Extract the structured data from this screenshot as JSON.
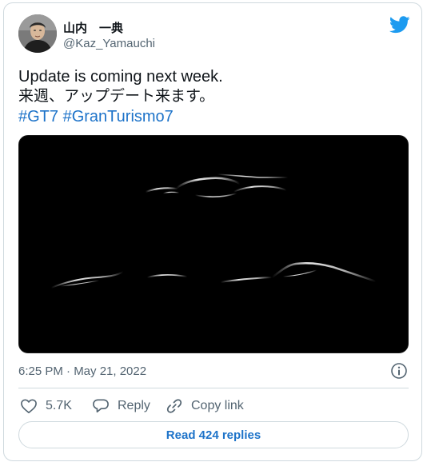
{
  "author": {
    "name": "山内　一典",
    "handle": "@Kaz_Yamauchi"
  },
  "tweet": {
    "line1": "Update is coming next week.",
    "line2": "来週、アップデート来ます。",
    "hashtags": [
      "#GT7",
      "#GranTurismo7"
    ]
  },
  "timestamp": "6:25 PM · May 21, 2022",
  "actions": {
    "like_count": "5.7K",
    "reply_label": "Reply",
    "copy_label": "Copy link"
  },
  "read_replies_label": "Read 424 replies",
  "colors": {
    "brand_blue": "#1d9bf0",
    "link_blue": "#1d73c9",
    "muted": "#536471",
    "border": "#cfd9de"
  },
  "icons": [
    "twitter-bird-icon",
    "info-icon",
    "heart-icon",
    "reply-icon",
    "link-icon"
  ]
}
